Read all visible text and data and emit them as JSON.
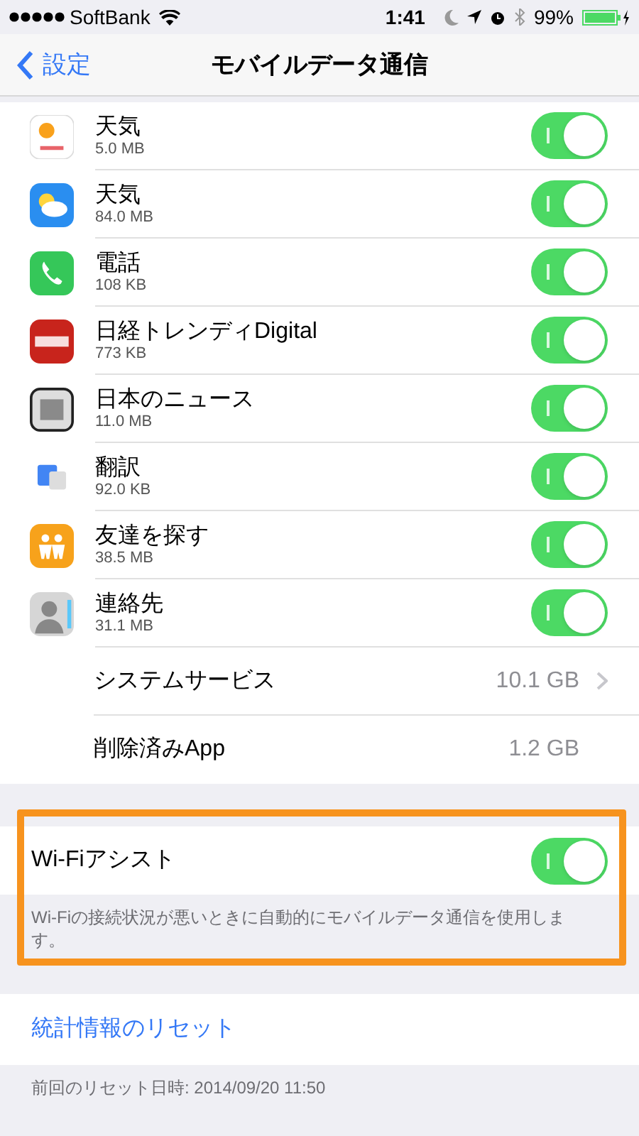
{
  "status_bar": {
    "carrier": "SoftBank",
    "time": "1:41",
    "battery": "99%"
  },
  "nav": {
    "back": "設定",
    "title": "モバイルデータ通信"
  },
  "apps": [
    {
      "name": "天気",
      "usage": "5.0 MB",
      "on": true
    },
    {
      "name": "天気",
      "usage": "84.0 MB",
      "on": true
    },
    {
      "name": "電話",
      "usage": "108 KB",
      "on": true
    },
    {
      "name": "日経トレンディDigital",
      "usage": "773 KB",
      "on": true
    },
    {
      "name": "日本のニュース",
      "usage": "11.0 MB",
      "on": true
    },
    {
      "name": "翻訳",
      "usage": "92.0 KB",
      "on": true
    },
    {
      "name": "友達を探す",
      "usage": "38.5 MB",
      "on": true
    },
    {
      "name": "連絡先",
      "usage": "31.1 MB",
      "on": true
    }
  ],
  "other_rows": [
    {
      "label": "システムサービス",
      "value": "10.1 GB",
      "chevron": true
    },
    {
      "label": "削除済みApp",
      "value": "1.2 GB",
      "chevron": false
    }
  ],
  "wifi_assist": {
    "label": "Wi-Fiアシスト",
    "on": true,
    "highlighted": true,
    "footer": "Wi-Fiの接続状況が悪いときに自動的にモバイルデータ通信を使用します。"
  },
  "reset": {
    "label": "統計情報のリセット",
    "footer": "前回のリセット日時: 2014/09/20 11:50"
  }
}
